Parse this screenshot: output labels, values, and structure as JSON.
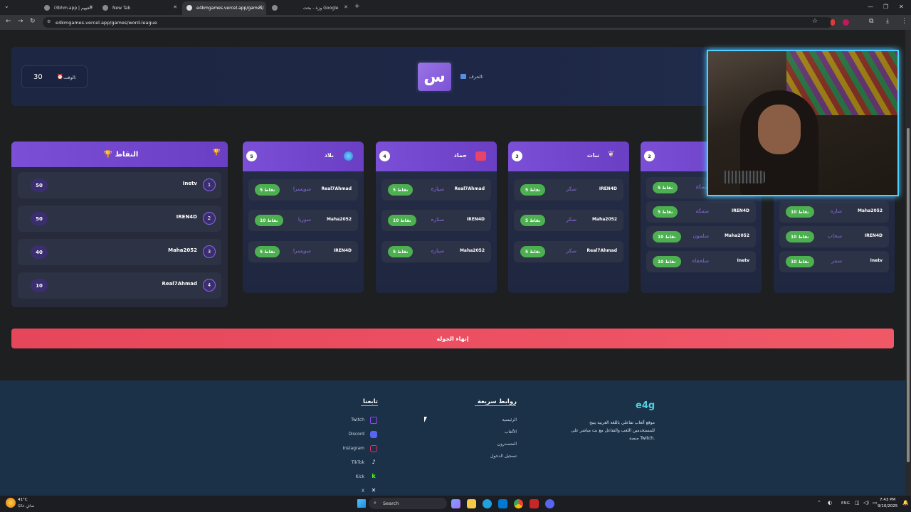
{
  "browser": {
    "tabs": [
      {
        "label": "i3bhm.app | العيهم"
      },
      {
        "label": "New Tab"
      },
      {
        "label": "e4kmgames.vercel.app/games/"
      },
      {
        "label": "وزة - بحث Google"
      }
    ],
    "url": "e4kmgames.vercel.app/games/word-league"
  },
  "game": {
    "time_label": "الوقت:",
    "time_value": "30",
    "letter_label": "الحرف:",
    "letter": "س"
  },
  "scoreboard": {
    "title": "النقاط",
    "rows": [
      {
        "rank": "1",
        "name": "Inetv",
        "points": "50"
      },
      {
        "rank": "2",
        "name": "IREN4D",
        "points": "50"
      },
      {
        "rank": "3",
        "name": "Maha2052",
        "points": "40"
      },
      {
        "rank": "4",
        "name": "Real7Ahmad",
        "points": "10"
      }
    ]
  },
  "categories": [
    {
      "num": "5",
      "title": "بلاد",
      "icon": "globe-icon",
      "rows": [
        {
          "player": "Real7Ahmad",
          "word": "سويسرا",
          "badge": "5 نقاط"
        },
        {
          "player": "Maha2052",
          "word": "سوريا",
          "badge": "10 نقاط"
        },
        {
          "player": "IREN4D",
          "word": "سويسرا",
          "badge": "5 نقاط"
        }
      ]
    },
    {
      "num": "4",
      "title": "جماد",
      "icon": "box-icon",
      "rows": [
        {
          "player": "Real7Ahmad",
          "word": "سيارة",
          "badge": "5 نقاط"
        },
        {
          "player": "IREN4D",
          "word": "ستاره",
          "badge": "10 نقاط"
        },
        {
          "player": "Maha2052",
          "word": "سياره",
          "badge": "5 نقاط"
        }
      ]
    },
    {
      "num": "3",
      "title": "نبات",
      "icon": "leaf-icon",
      "rows": [
        {
          "player": "IREN4D",
          "word": "سكر",
          "badge": "5 نقاط"
        },
        {
          "player": "Maha2052",
          "word": "سكر",
          "badge": "5 نقاط"
        },
        {
          "player": "Real7Ahmad",
          "word": "سكر",
          "badge": "5 نقاط"
        }
      ]
    },
    {
      "num": "2",
      "title": "",
      "icon": "fish-icon",
      "rows": [
        {
          "player": "",
          "word": "سمكة",
          "badge": "5 نقاط"
        },
        {
          "player": "IREN4D",
          "word": "سمكه",
          "badge": "5 نقاط"
        },
        {
          "player": "Maha2052",
          "word": "سلمون",
          "badge": "10 نقاط"
        },
        {
          "player": "Inetv",
          "word": "سلحفاه",
          "badge": "10 نقاط"
        }
      ]
    },
    {
      "num": "",
      "title": "",
      "icon": "",
      "rows": [
        {
          "player": "",
          "word": "",
          "badge": ""
        },
        {
          "player": "Maha2052",
          "word": "ساره",
          "badge": "10 نقاط"
        },
        {
          "player": "IREN4D",
          "word": "سحاب",
          "badge": "10 نقاط"
        },
        {
          "player": "Inetv",
          "word": "سمر",
          "badge": "10 نقاط"
        }
      ]
    }
  ],
  "end_round_label": "إنهاء الجولة",
  "footer": {
    "brand": "e4g",
    "description_line1": "موقع ألعاب تفاعلي باللغة العربية يتيح",
    "description_line2": "للمستخدمين اللعب والتفاعل مع بث مباشر على",
    "description_line3": "منصة Twitch.",
    "quick_links_title": "روابط سريعة",
    "quick_links": [
      "الرئيسية",
      "الألعاب",
      "المتصدرون",
      "تسجيل الدخول"
    ],
    "follow_title": "تابعنا",
    "social": [
      {
        "label": "Twitch",
        "icon": "twitch-icon",
        "color": "#9146ff"
      },
      {
        "label": "Discord",
        "icon": "discord-icon",
        "color": "#5865f2"
      },
      {
        "label": "Instagram",
        "icon": "instagram-icon",
        "color": "#e1306c"
      },
      {
        "label": "TikTok",
        "icon": "tiktok-icon",
        "color": "#ffffff"
      },
      {
        "label": "Kick",
        "icon": "kick-icon",
        "color": "#53fc18"
      },
      {
        "label": "X",
        "icon": "x-icon",
        "color": "#ffffff"
      }
    ]
  },
  "taskbar": {
    "weather_temp": "41°C",
    "weather_desc": "صافٍ غالبًا",
    "search_placeholder": "Search",
    "lang": "ENG",
    "time": "7:43 PM",
    "date": "9/10/2025"
  },
  "colors": {
    "accent_purple": "#7b4fd6",
    "badge_green": "#4caf50",
    "end_button": "#e6465a",
    "footer_bg": "#1a3148",
    "brand_teal": "#4fd0e0"
  }
}
